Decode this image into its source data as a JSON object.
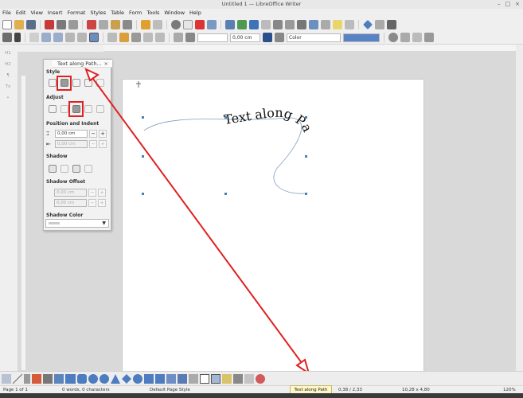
{
  "window": {
    "title": "Untitled 1 — LibreOffice Writer"
  },
  "menu": [
    "File",
    "Edit",
    "View",
    "Insert",
    "Format",
    "Styles",
    "Table",
    "Form",
    "Tools",
    "Window",
    "Help"
  ],
  "toolbar2": {
    "line_width": "0,00 cm",
    "area_style": "Color"
  },
  "panel": {
    "title": "Text along Path...",
    "close": "×",
    "sections": {
      "style": "Style",
      "adjust": "Adjust",
      "position": "Position and Indent",
      "shadow": "Shadow",
      "shadow_offset": "Shadow Offset",
      "shadow_color": "Shadow Color"
    },
    "distance_value": "0,00 cm",
    "indent_value": "0,00 cm",
    "offset_x": "0,00 cm",
    "offset_y": "0,00 cm"
  },
  "document": {
    "fontwork_text": "Text along Path"
  },
  "tooltip": "Text along Path",
  "status": {
    "page": "Page 1 of 1",
    "words": "0 words, 0 characters",
    "page_style": "Default Page Style",
    "position": "0,38 / 2,33",
    "size": "10,28 x 4,80",
    "zoom": "120%"
  },
  "colors": {
    "highlight": "#e02020",
    "selection_handle": "#4a7fb0"
  },
  "icons": [
    "save-icon",
    "open-icon",
    "undo-icon",
    "redo-icon",
    "fontwork-icon",
    "close-icon"
  ]
}
